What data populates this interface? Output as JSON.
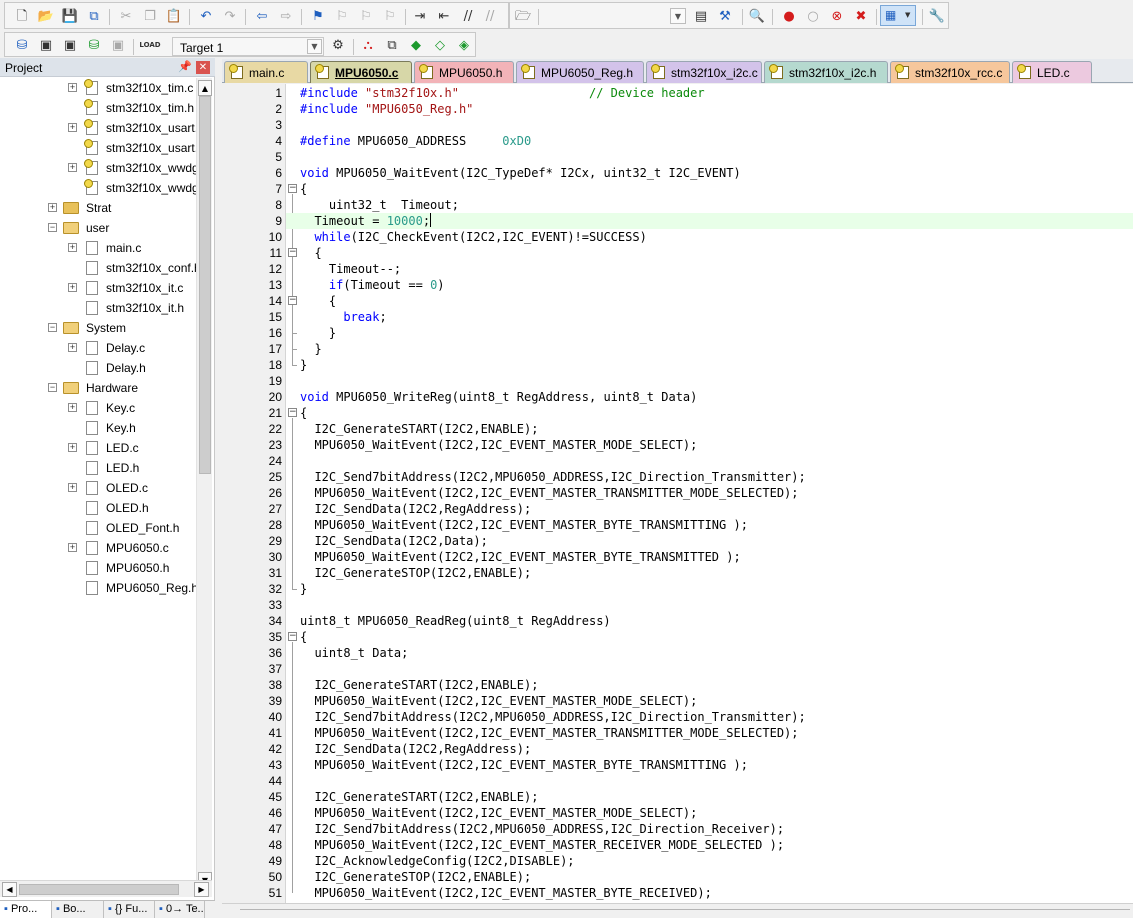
{
  "toolbar1": {
    "buttons": [
      "new-file",
      "open-file",
      "save",
      "save-all",
      "cut",
      "copy",
      "paste",
      "undo",
      "redo",
      "navigate-back",
      "navigate-forward",
      "insert-bookmark",
      "prev-bookmark",
      "next-bookmark",
      "clear-bookmarks",
      "indent",
      "unindent",
      "comment",
      "uncomment",
      "find-in-files",
      "find-combo",
      "debug-search",
      "configure",
      "start-debug",
      "breakpoint",
      "disable-breakpoint",
      "disable-all-breakpoints",
      "kill-all-breakpoints",
      "window-layout",
      "config-tools"
    ]
  },
  "toolbar2": {
    "target_label": "Target 1"
  },
  "project": {
    "title": "Project",
    "pin_icon": "pin-icon",
    "close_icon": "close-icon",
    "tree": [
      {
        "label": "stm32f10x_tim.c",
        "kind": "file",
        "star": true,
        "expand": "+",
        "level": 3
      },
      {
        "label": "stm32f10x_tim.h",
        "kind": "file",
        "star": true,
        "expand": "",
        "level": 3
      },
      {
        "label": "stm32f10x_usart.",
        "kind": "file",
        "star": true,
        "expand": "+",
        "level": 3
      },
      {
        "label": "stm32f10x_usart.",
        "kind": "file",
        "star": true,
        "expand": "",
        "level": 3
      },
      {
        "label": "stm32f10x_wwdg",
        "kind": "file",
        "star": true,
        "expand": "+",
        "level": 3
      },
      {
        "label": "stm32f10x_wwdg",
        "kind": "file",
        "star": true,
        "expand": "",
        "level": 3
      },
      {
        "label": "Strat",
        "kind": "folder",
        "open": false,
        "expand": "+",
        "level": 2
      },
      {
        "label": "user",
        "kind": "folder",
        "open": true,
        "expand": "-",
        "level": 2
      },
      {
        "label": "main.c",
        "kind": "file",
        "star": false,
        "expand": "+",
        "level": 3
      },
      {
        "label": "stm32f10x_conf.h",
        "kind": "file",
        "star": false,
        "expand": "",
        "level": 3
      },
      {
        "label": "stm32f10x_it.c",
        "kind": "file",
        "star": false,
        "expand": "+",
        "level": 3
      },
      {
        "label": "stm32f10x_it.h",
        "kind": "file",
        "star": false,
        "expand": "",
        "level": 3
      },
      {
        "label": "System",
        "kind": "folder",
        "open": true,
        "expand": "-",
        "level": 2
      },
      {
        "label": "Delay.c",
        "kind": "file",
        "star": false,
        "expand": "+",
        "level": 3
      },
      {
        "label": "Delay.h",
        "kind": "file",
        "star": false,
        "expand": "",
        "level": 3
      },
      {
        "label": "Hardware",
        "kind": "folder",
        "open": true,
        "expand": "-",
        "level": 2
      },
      {
        "label": "Key.c",
        "kind": "file",
        "star": false,
        "expand": "+",
        "level": 3
      },
      {
        "label": "Key.h",
        "kind": "file",
        "star": false,
        "expand": "",
        "level": 3
      },
      {
        "label": "LED.c",
        "kind": "file",
        "star": false,
        "expand": "+",
        "level": 3
      },
      {
        "label": "LED.h",
        "kind": "file",
        "star": false,
        "expand": "",
        "level": 3
      },
      {
        "label": "OLED.c",
        "kind": "file",
        "star": false,
        "expand": "+",
        "level": 3
      },
      {
        "label": "OLED.h",
        "kind": "file",
        "star": false,
        "expand": "",
        "level": 3
      },
      {
        "label": "OLED_Font.h",
        "kind": "file",
        "star": false,
        "expand": "",
        "level": 3
      },
      {
        "label": "MPU6050.c",
        "kind": "file",
        "star": false,
        "expand": "+",
        "level": 3
      },
      {
        "label": "MPU6050.h",
        "kind": "file",
        "star": false,
        "expand": "",
        "level": 3
      },
      {
        "label": "MPU6050_Reg.h",
        "kind": "file",
        "star": false,
        "expand": "",
        "level": 3
      }
    ],
    "bottom_tabs": [
      {
        "label": "Pro...",
        "icon": "project-icon",
        "active": true
      },
      {
        "label": "Bo...",
        "icon": "books-icon",
        "active": false
      },
      {
        "label": "{} Fu...",
        "icon": "functions-icon",
        "active": false
      },
      {
        "label": "0→ Te...",
        "icon": "templates-icon",
        "active": false
      }
    ]
  },
  "tabs": [
    {
      "label": "main.c",
      "color": "#e8d9a4",
      "active": false
    },
    {
      "label": "MPU6050.c",
      "color": "#d7d7a8",
      "active": true
    },
    {
      "label": "MPU6050.h",
      "color": "#f2b3b8",
      "active": false
    },
    {
      "label": "MPU6050_Reg.h",
      "color": "#d3c3ea",
      "active": false
    },
    {
      "label": "stm32f10x_i2c.c",
      "color": "#d3c3ea",
      "active": false
    },
    {
      "label": "stm32f10x_i2c.h",
      "color": "#b5d9cf",
      "active": false
    },
    {
      "label": "stm32f10x_rcc.c",
      "color": "#f6c79c",
      "active": false
    },
    {
      "label": "LED.c",
      "color": "#ecc9df",
      "active": false
    }
  ],
  "editor": {
    "current_line": 9,
    "lines": [
      {
        "n": 1,
        "t": "#include \"stm32f10x.h\"                  // Device header"
      },
      {
        "n": 2,
        "t": "#include \"MPU6050_Reg.h\""
      },
      {
        "n": 3,
        "t": ""
      },
      {
        "n": 4,
        "t": "#define MPU6050_ADDRESS     0xD0"
      },
      {
        "n": 5,
        "t": ""
      },
      {
        "n": 6,
        "t": "void MPU6050_WaitEvent(I2C_TypeDef* I2Cx, uint32_t I2C_EVENT)"
      },
      {
        "n": 7,
        "t": "{"
      },
      {
        "n": 8,
        "t": "    uint32_t  Timeout;"
      },
      {
        "n": 9,
        "t": "  Timeout = 10000;"
      },
      {
        "n": 10,
        "t": "  while(I2C_CheckEvent(I2C2,I2C_EVENT)!=SUCCESS)"
      },
      {
        "n": 11,
        "t": "  {"
      },
      {
        "n": 12,
        "t": "    Timeout--;"
      },
      {
        "n": 13,
        "t": "    if(Timeout == 0)"
      },
      {
        "n": 14,
        "t": "    {"
      },
      {
        "n": 15,
        "t": "      break;"
      },
      {
        "n": 16,
        "t": "    }"
      },
      {
        "n": 17,
        "t": "  }"
      },
      {
        "n": 18,
        "t": "}"
      },
      {
        "n": 19,
        "t": ""
      },
      {
        "n": 20,
        "t": "void MPU6050_WriteReg(uint8_t RegAddress, uint8_t Data)"
      },
      {
        "n": 21,
        "t": "{"
      },
      {
        "n": 22,
        "t": "  I2C_GenerateSTART(I2C2,ENABLE);"
      },
      {
        "n": 23,
        "t": "  MPU6050_WaitEvent(I2C2,I2C_EVENT_MASTER_MODE_SELECT);"
      },
      {
        "n": 24,
        "t": ""
      },
      {
        "n": 25,
        "t": "  I2C_Send7bitAddress(I2C2,MPU6050_ADDRESS,I2C_Direction_Transmitter);"
      },
      {
        "n": 26,
        "t": "  MPU6050_WaitEvent(I2C2,I2C_EVENT_MASTER_TRANSMITTER_MODE_SELECTED);"
      },
      {
        "n": 27,
        "t": "  I2C_SendData(I2C2,RegAddress);"
      },
      {
        "n": 28,
        "t": "  MPU6050_WaitEvent(I2C2,I2C_EVENT_MASTER_BYTE_TRANSMITTING );"
      },
      {
        "n": 29,
        "t": "  I2C_SendData(I2C2,Data);"
      },
      {
        "n": 30,
        "t": "  MPU6050_WaitEvent(I2C2,I2C_EVENT_MASTER_BYTE_TRANSMITTED );"
      },
      {
        "n": 31,
        "t": "  I2C_GenerateSTOP(I2C2,ENABLE);"
      },
      {
        "n": 32,
        "t": "}"
      },
      {
        "n": 33,
        "t": ""
      },
      {
        "n": 34,
        "t": "uint8_t MPU6050_ReadReg(uint8_t RegAddress)"
      },
      {
        "n": 35,
        "t": "{"
      },
      {
        "n": 36,
        "t": "  uint8_t Data;"
      },
      {
        "n": 37,
        "t": ""
      },
      {
        "n": 38,
        "t": "  I2C_GenerateSTART(I2C2,ENABLE);"
      },
      {
        "n": 39,
        "t": "  MPU6050_WaitEvent(I2C2,I2C_EVENT_MASTER_MODE_SELECT);"
      },
      {
        "n": 40,
        "t": "  I2C_Send7bitAddress(I2C2,MPU6050_ADDRESS,I2C_Direction_Transmitter);"
      },
      {
        "n": 41,
        "t": "  MPU6050_WaitEvent(I2C2,I2C_EVENT_MASTER_TRANSMITTER_MODE_SELECTED);"
      },
      {
        "n": 42,
        "t": "  I2C_SendData(I2C2,RegAddress);"
      },
      {
        "n": 43,
        "t": "  MPU6050_WaitEvent(I2C2,I2C_EVENT_MASTER_BYTE_TRANSMITTING );"
      },
      {
        "n": 44,
        "t": ""
      },
      {
        "n": 45,
        "t": "  I2C_GenerateSTART(I2C2,ENABLE);"
      },
      {
        "n": 46,
        "t": "  MPU6050_WaitEvent(I2C2,I2C_EVENT_MASTER_MODE_SELECT);"
      },
      {
        "n": 47,
        "t": "  I2C_Send7bitAddress(I2C2,MPU6050_ADDRESS,I2C_Direction_Receiver);"
      },
      {
        "n": 48,
        "t": "  MPU6050_WaitEvent(I2C2,I2C_EVENT_MASTER_RECEIVER_MODE_SELECTED );"
      },
      {
        "n": 49,
        "t": "  I2C_AcknowledgeConfig(I2C2,DISABLE);"
      },
      {
        "n": 50,
        "t": "  I2C_GenerateSTOP(I2C2,ENABLE);"
      },
      {
        "n": 51,
        "t": "  MPU6050_WaitEvent(I2C2,I2C_EVENT_MASTER_BYTE_RECEIVED);"
      }
    ],
    "folds": [
      {
        "start": 7,
        "end": 18
      },
      {
        "start": 11,
        "end": 17
      },
      {
        "start": 14,
        "end": 16
      },
      {
        "start": 21,
        "end": 32
      },
      {
        "start": 35,
        "end": 51
      }
    ],
    "keywords": [
      "#include",
      "#define",
      "void",
      "while",
      "if",
      "break"
    ]
  }
}
